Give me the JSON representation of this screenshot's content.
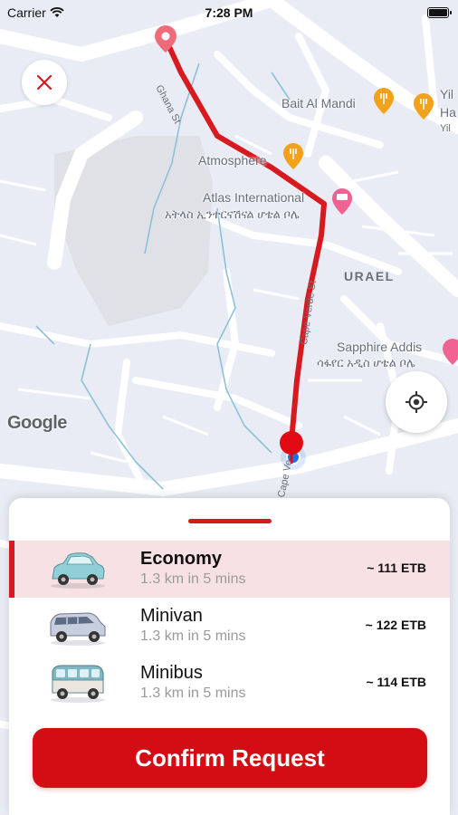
{
  "status_bar": {
    "carrier": "Carrier",
    "time": "7:28 PM"
  },
  "map": {
    "pois": [
      {
        "name": "Bait Al Mandi"
      },
      {
        "name": "Yil"
      },
      {
        "name": "Ha"
      },
      {
        "name": "Yil"
      },
      {
        "name": "Atmosphere"
      },
      {
        "name": "Atlas International",
        "name_local": "አትላስ ኢንተርናሽናል ሆቴል ቦሌ"
      },
      {
        "name": "Sapphire Addis",
        "name_local": "ሳፋየር አዲስ ሆቴል ቦሌ"
      }
    ],
    "area_label": "URAEL",
    "streets": [
      "Ghana St",
      "Cape Verde St",
      "Cape Ve"
    ],
    "attribution": "Google",
    "route_color": "#d71920"
  },
  "sheet": {
    "rides": [
      {
        "name": "Economy",
        "subtitle": "1.3 km in 5 mins",
        "price": "~ 111 ETB",
        "selected": true,
        "icon": "car-icon"
      },
      {
        "name": "Minivan",
        "subtitle": "1.3 km in 5 mins",
        "price": "~ 122 ETB",
        "selected": false,
        "icon": "minivan-icon"
      },
      {
        "name": "Minibus",
        "subtitle": "1.3 km in 5 mins",
        "price": "~ 114 ETB",
        "selected": false,
        "icon": "minibus-icon"
      }
    ],
    "confirm_label": "Confirm Request"
  },
  "colors": {
    "accent": "#d71920",
    "selected_row": "#f7e1e4"
  }
}
